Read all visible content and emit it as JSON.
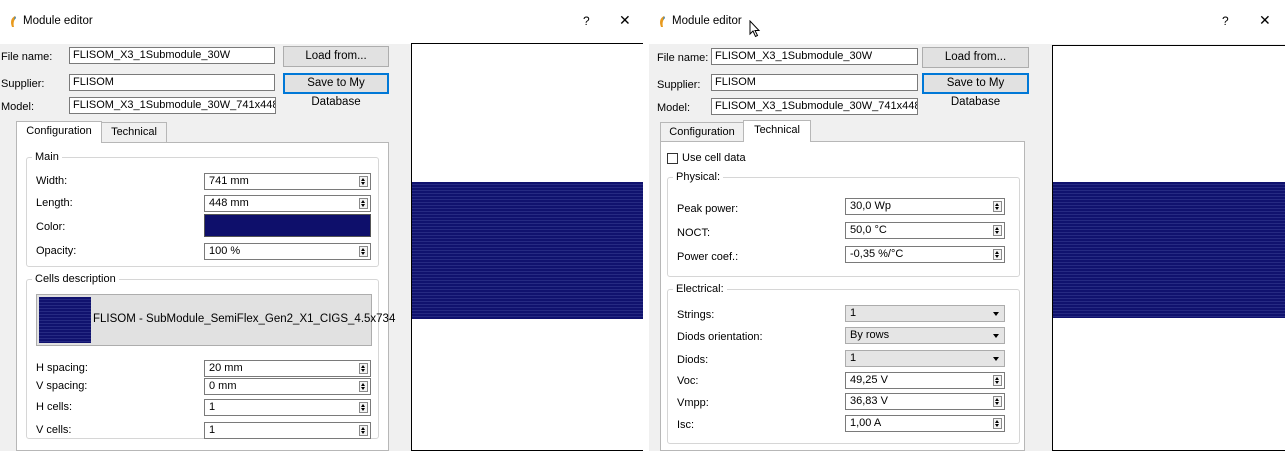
{
  "colors": {
    "module": "#0e0f6b",
    "cells": "#10126e",
    "focus": "#0078d7"
  },
  "left": {
    "title": "Module editor",
    "help": "?",
    "close": "✕",
    "file_name_label": "File name:",
    "file_name": "FLISOM_X3_1Submodule_30W",
    "load_button": "Load from...",
    "supplier_label": "Supplier:",
    "supplier": "FLISOM",
    "save_button": "Save to My Database",
    "model_label": "Model:",
    "model": "FLISOM_X3_1Submodule_30W_741x448",
    "tabs": [
      "Configuration",
      "Technical"
    ],
    "main": {
      "title": "Main",
      "width_label": "Width:",
      "width": "741 mm",
      "length_label": "Length:",
      "length": "448 mm",
      "color_label": "Color:",
      "opacity_label": "Opacity:",
      "opacity": "100 %"
    },
    "cells": {
      "title": "Cells description",
      "name": "FLISOM - SubModule_SemiFlex_Gen2_X1_CIGS_4.5x734",
      "h_spacing_label": "H spacing:",
      "h_spacing": "20 mm",
      "v_spacing_label": "V spacing:",
      "v_spacing": "0 mm",
      "h_cells_label": "H cells:",
      "h_cells": "1",
      "v_cells_label": "V cells:",
      "v_cells": "1"
    }
  },
  "right": {
    "title": "Module editor",
    "help": "?",
    "close": "✕",
    "file_name_label": "File name:",
    "file_name": "FLISOM_X3_1Submodule_30W",
    "load_button": "Load from...",
    "supplier_label": "Supplier:",
    "supplier": "FLISOM",
    "save_button": "Save to My Database",
    "model_label": "Model:",
    "model": "FLISOM_X3_1Submodule_30W_741x448",
    "tabs": [
      "Configuration",
      "Technical"
    ],
    "use_cell_data": "Use cell data",
    "physical": {
      "title": "Physical:",
      "peak_power_label": "Peak power:",
      "peak_power": "30,0 Wp",
      "noct_label": "NOCT:",
      "noct": "50,0 °C",
      "power_coef_label": "Power coef.:",
      "power_coef": "-0,35 %/°C"
    },
    "electrical": {
      "title": "Electrical:",
      "strings_label": "Strings:",
      "strings": "1",
      "diods_orientation_label": "Diods orientation:",
      "diods_orientation": "By rows",
      "diods_label": "Diods:",
      "diods": "1",
      "voc_label": "Voc:",
      "voc": "49,25 V",
      "vmpp_label": "Vmpp:",
      "vmpp": "36,83 V",
      "isc_label": "Isc:",
      "isc": "1,00 A"
    }
  }
}
